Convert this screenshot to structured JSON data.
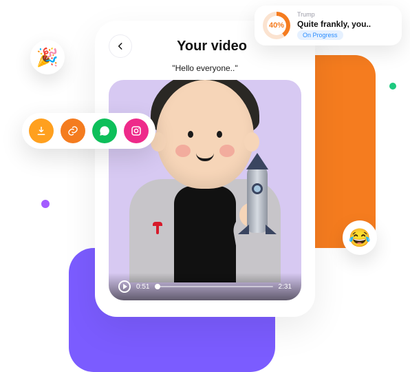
{
  "video_card": {
    "title": "Your video",
    "caption": "\"Hello everyone..\"",
    "current_time": "0:51",
    "duration": "2:31",
    "avatar_logo_icon": "tesla-logo-icon",
    "avatar_prop_icon": "rocket-icon"
  },
  "share": {
    "download_icon": "download-icon",
    "link_icon": "link-icon",
    "chat_icon": "chat-bubble-icon",
    "instagram_icon": "instagram-icon"
  },
  "bubbles": {
    "party": "🎉",
    "laugh": "😂"
  },
  "progress_card": {
    "percent_label": "40%",
    "subtitle": "Trump",
    "title": "Quite frankly, you..",
    "status": "On Progress"
  }
}
